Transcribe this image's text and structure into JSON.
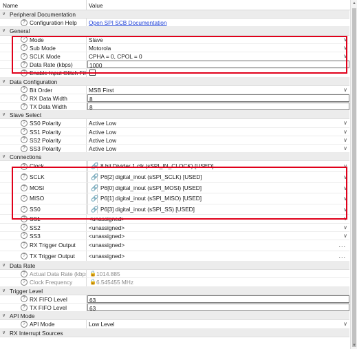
{
  "header": {
    "name": "Name",
    "value": "Value"
  },
  "icons": {
    "help": "?",
    "expanded": "∨",
    "dropdown": "∨",
    "link": "🔗",
    "lock": "🔒"
  },
  "rows": [
    {
      "type": "cat",
      "label": "Peripheral Documentation"
    },
    {
      "type": "prop",
      "name": "Configuration Help",
      "value": "Open SPI SCB Documentation",
      "kind": "link"
    },
    {
      "type": "cat",
      "label": "General"
    },
    {
      "type": "prop",
      "name": "Mode",
      "value": "Slave",
      "kind": "dropdown"
    },
    {
      "type": "prop",
      "name": "Sub Mode",
      "value": "Motorola",
      "kind": "dropdown"
    },
    {
      "type": "prop",
      "name": "SCLK Mode",
      "value": "CPHA = 0, CPOL = 0",
      "kind": "dropdown"
    },
    {
      "type": "prop",
      "name": "Data Rate (kbps)",
      "value": "1000",
      "kind": "text"
    },
    {
      "type": "prop",
      "name": "Enable Input Glitch Filter",
      "value": "",
      "kind": "checkbox"
    },
    {
      "type": "cat",
      "label": "Data Configuration"
    },
    {
      "type": "prop",
      "name": "Bit Order",
      "value": "MSB First",
      "kind": "dropdown"
    },
    {
      "type": "prop",
      "name": "RX Data Width",
      "value": "8",
      "kind": "text"
    },
    {
      "type": "prop",
      "name": "TX Data Width",
      "value": "8",
      "kind": "text"
    },
    {
      "type": "cat",
      "label": "Slave Select"
    },
    {
      "type": "prop",
      "name": "SS0 Polarity",
      "value": "Active Low",
      "kind": "dropdown"
    },
    {
      "type": "prop",
      "name": "SS1 Polarity",
      "value": "Active Low",
      "kind": "dropdown"
    },
    {
      "type": "prop",
      "name": "SS2 Polarity",
      "value": "Active Low",
      "kind": "dropdown"
    },
    {
      "type": "prop",
      "name": "SS3 Polarity",
      "value": "Active Low",
      "kind": "dropdown"
    },
    {
      "type": "cat",
      "label": "Connections"
    },
    {
      "type": "prop",
      "name": "Clock",
      "value": "8 bit Divider 1 clk (sSPI_IN_CLOCK) [USED]",
      "kind": "connection"
    },
    {
      "type": "prop",
      "name": "SCLK",
      "value": "P6[2] digital_inout (sSPI_SCLK) [USED]",
      "kind": "connection"
    },
    {
      "type": "prop",
      "name": "MOSI",
      "value": "P6[0] digital_inout (sSPI_MOSI) [USED]",
      "kind": "connection"
    },
    {
      "type": "prop",
      "name": "MISO",
      "value": "P6[1] digital_inout (sSPI_MISO) [USED]",
      "kind": "connection"
    },
    {
      "type": "prop",
      "name": "SS0",
      "value": "P6[3] digital_inout (sSPI_SS) [USED]",
      "kind": "connection"
    },
    {
      "type": "prop",
      "name": "SS1",
      "value": "<unassigned>",
      "kind": "dropdown"
    },
    {
      "type": "prop",
      "name": "SS2",
      "value": "<unassigned>",
      "kind": "dropdown"
    },
    {
      "type": "prop",
      "name": "SS3",
      "value": "<unassigned>",
      "kind": "dropdown"
    },
    {
      "type": "prop",
      "name": "RX Trigger Output",
      "value": "<unassigned>",
      "kind": "ellipsis"
    },
    {
      "type": "prop",
      "name": "TX Trigger Output",
      "value": "<unassigned>",
      "kind": "ellipsis"
    },
    {
      "type": "cat",
      "label": "Data Rate"
    },
    {
      "type": "prop",
      "name": "Actual Data Rate (kbps)",
      "value": "1014.885",
      "kind": "readonly"
    },
    {
      "type": "prop",
      "name": "Clock Frequency",
      "value": "6.545455 MHz",
      "kind": "readonly"
    },
    {
      "type": "cat",
      "label": "Trigger Level"
    },
    {
      "type": "prop",
      "name": "RX FIFO Level",
      "value": "63",
      "kind": "text"
    },
    {
      "type": "prop",
      "name": "TX FIFO Level",
      "value": "63",
      "kind": "text"
    },
    {
      "type": "cat",
      "label": "API Mode"
    },
    {
      "type": "prop",
      "name": "API Mode",
      "value": "Low Level",
      "kind": "dropdown"
    },
    {
      "type": "cat",
      "label": "RX Interrupt Sources"
    }
  ],
  "highlight_color": "#e0001a"
}
